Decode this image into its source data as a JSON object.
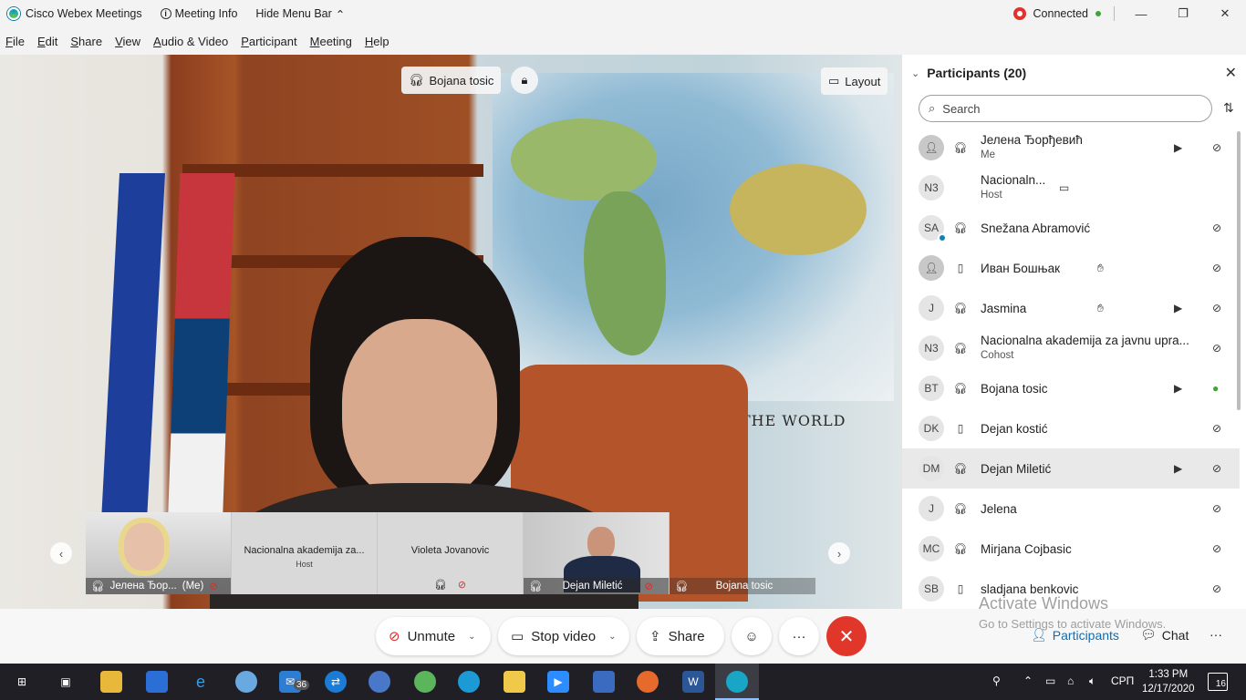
{
  "titlebar": {
    "app_name": "Cisco Webex Meetings",
    "meeting_info": "Meeting Info",
    "hide_menu_bar": "Hide Menu Bar",
    "connection_status": "Connected",
    "minimize": "—",
    "restore": "❐",
    "close": "✕"
  },
  "menu": [
    "File",
    "Edit",
    "Share",
    "View",
    "Audio & Video",
    "Participant",
    "Meeting",
    "Help"
  ],
  "stage": {
    "active_speaker": "Bojana tosic",
    "layout_label": "Layout",
    "background_text": "THE WORLD",
    "thumbnails": [
      {
        "name": "Јелена Ђор...",
        "me_tag": "(Me)",
        "video": true
      },
      {
        "name": "Nacionalna akademija za...",
        "role": "Host",
        "video": false
      },
      {
        "name": "Violeta Jovanovic",
        "video": false
      },
      {
        "name": "Dejan Miletić",
        "video": true
      },
      {
        "name": "Bojana tosic",
        "video": false
      }
    ]
  },
  "participants_panel": {
    "title": "Participants (20)",
    "search_placeholder": "Search",
    "participants": [
      {
        "initials": "",
        "name": "Јелена Ђорђевић",
        "role": "Me",
        "audio": "headset",
        "camera": true,
        "mic_muted": true
      },
      {
        "initials": "N3",
        "name": "Nacionaln...",
        "role": "Host",
        "audio": "",
        "cc": true,
        "mic_muted": false
      },
      {
        "initials": "SA",
        "name": "Snežana Abramović",
        "audio": "headset",
        "mic_muted": true,
        "presence": true
      },
      {
        "initials": "",
        "name": "Иван Бошњак",
        "audio": "phone",
        "hand": true,
        "mic_muted": true
      },
      {
        "initials": "J",
        "name": "Jasmina",
        "audio": "headset",
        "hand": true,
        "camera": true,
        "mic_muted": true
      },
      {
        "initials": "N3",
        "name": "Nacionalna akademija za javnu upra...",
        "role": "Cohost",
        "audio": "headset",
        "mic_muted": true
      },
      {
        "initials": "BT",
        "name": "Bojana tosic",
        "audio": "headset",
        "camera": true,
        "mic_muted": false,
        "speaking": true
      },
      {
        "initials": "DK",
        "name": "Dejan kostić",
        "audio": "phone",
        "mic_muted": true
      },
      {
        "initials": "DM",
        "name": "Dejan Miletić",
        "audio": "headset",
        "camera": true,
        "mic_muted": true,
        "highlighted": true
      },
      {
        "initials": "J",
        "name": "Jelena",
        "audio": "headset",
        "mic_muted": true
      },
      {
        "initials": "MC",
        "name": "Mirjana Cojbasic",
        "audio": "headset",
        "mic_muted": true
      },
      {
        "initials": "SB",
        "name": "sladjana benkovic",
        "audio": "phone",
        "mic_muted": true
      }
    ]
  },
  "watermark": {
    "line1": "Activate Windows",
    "line2": "Go to Settings to activate Windows."
  },
  "controls": {
    "unmute": "Unmute",
    "stop_video": "Stop video",
    "share": "Share",
    "participants": "Participants",
    "chat": "Chat"
  },
  "taskbar": {
    "mail_badge": "36",
    "language": "СРП",
    "time": "1:33 PM",
    "date": "12/17/2020",
    "notifications": "16"
  },
  "colors": {
    "end_call": "#e0372a",
    "participants_link": "#0a6fb5",
    "muted_mic": "#d32f2f",
    "speaking_mic": "#3fa535"
  }
}
